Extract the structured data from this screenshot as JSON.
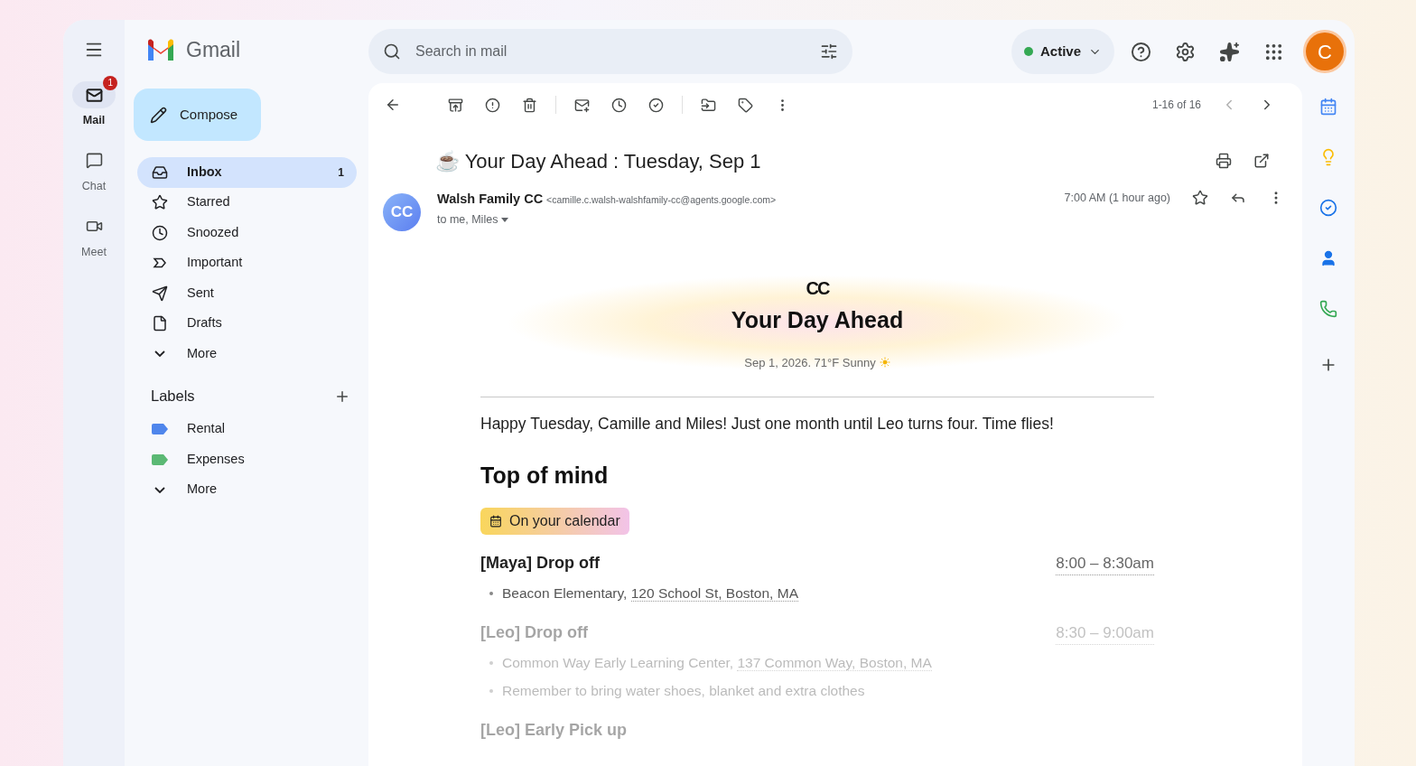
{
  "app": {
    "name": "Gmail"
  },
  "rail": [
    {
      "label": "Mail",
      "selected": true,
      "badge": "1"
    },
    {
      "label": "Chat",
      "selected": false
    },
    {
      "label": "Meet",
      "selected": false
    }
  ],
  "compose": "Compose",
  "folders": [
    {
      "label": "Inbox",
      "count": "1",
      "selected": true
    },
    {
      "label": "Starred",
      "selected": false
    },
    {
      "label": "Snoozed",
      "selected": false
    },
    {
      "label": "Important",
      "selected": false
    },
    {
      "label": "Sent",
      "selected": false
    },
    {
      "label": "Drafts",
      "selected": false
    },
    {
      "label": "More",
      "selected": false
    }
  ],
  "labels": {
    "title": "Labels",
    "items": [
      {
        "label": "Rental",
        "color": "#4f86ec"
      },
      {
        "label": "Expenses",
        "color": "#5bb974"
      }
    ],
    "more": "More"
  },
  "search": {
    "placeholder": "Search in mail"
  },
  "status": {
    "label": "Active",
    "color": "#34a853"
  },
  "avatar": "C",
  "pager": "1-16 of 16",
  "message": {
    "subject": "☕ Your Day Ahead : Tuesday, Sep 1",
    "sender": {
      "avatar": "CC",
      "name": "Walsh Family CC",
      "email": "<camille.c.walsh-walshfamily-cc@agents.google.com>",
      "to": "to me, Miles",
      "time": "7:00 AM (1 hour ago)"
    },
    "body": {
      "logo": "CC",
      "title": "Your Day Ahead",
      "dateline": "Sep 1, 2026. 71°F Sunny",
      "greeting": "Happy Tuesday, Camille and Miles! Just one month until Leo turns four. Time flies!",
      "section": "Top of mind",
      "chip": "On your calendar",
      "events": [
        {
          "title": "[Maya] Drop off",
          "time": "8:00 – 8:30am",
          "dimmed": false,
          "details": [
            {
              "text": "Beacon Elementary, ",
              "link": "120 School St, Boston, MA"
            }
          ]
        },
        {
          "title": "[Leo] Drop off",
          "time": "8:30 – 9:00am",
          "dimmed": true,
          "details": [
            {
              "text": "Common Way Early Learning Center, ",
              "link": "137 Common Way, Boston, MA"
            },
            {
              "text": "Remember to bring water shoes, blanket and extra clothes"
            }
          ]
        },
        {
          "title": "[Leo] Early Pick up",
          "dimmed": true
        }
      ]
    }
  }
}
